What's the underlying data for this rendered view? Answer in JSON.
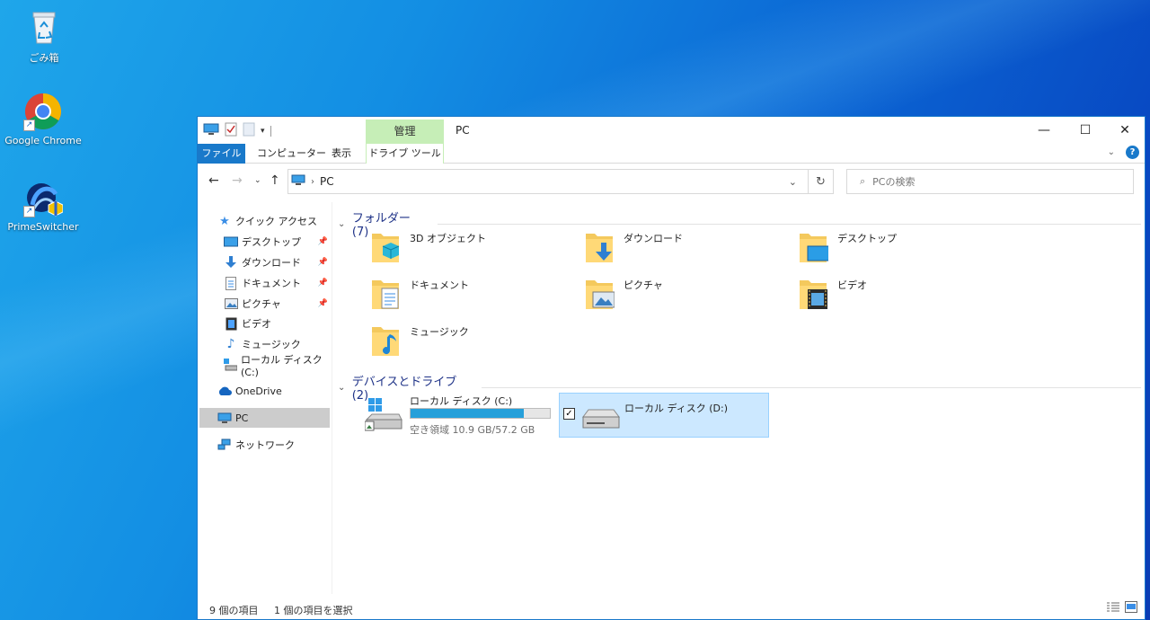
{
  "desktop": {
    "icons": [
      {
        "label": "ごみ箱",
        "icon": "recycle-bin-icon"
      },
      {
        "label": "Google Chrome",
        "icon": "chrome-icon"
      },
      {
        "label": "PrimeSwitcher",
        "icon": "primeswitcher-icon"
      }
    ]
  },
  "window": {
    "title": "PC",
    "context_tab_group": "管理",
    "ribbon_tabs": [
      "ファイル",
      "コンピューター",
      "表示",
      "ドライブ ツール"
    ],
    "address": {
      "path": "PC"
    },
    "search": {
      "placeholder": "PCの検索"
    },
    "controls": {
      "minimize": "—",
      "maximize": "☐",
      "close": "✕"
    }
  },
  "sidebar": {
    "quick_access": "クイック アクセス",
    "items": [
      {
        "label": "デスクトップ",
        "icon": "desktop-icon",
        "pinned": true
      },
      {
        "label": "ダウンロード",
        "icon": "download-icon",
        "pinned": true
      },
      {
        "label": "ドキュメント",
        "icon": "document-icon",
        "pinned": true
      },
      {
        "label": "ピクチャ",
        "icon": "picture-icon",
        "pinned": true
      },
      {
        "label": "ビデオ",
        "icon": "video-icon",
        "pinned": false
      },
      {
        "label": "ミュージック",
        "icon": "music-icon",
        "pinned": false
      },
      {
        "label": "ローカル ディスク (C:)",
        "icon": "drive-icon",
        "pinned": false
      }
    ],
    "onedrive": "OneDrive",
    "pc": "PC",
    "network": "ネットワーク"
  },
  "content": {
    "folders_header": "フォルダー (7)",
    "folders": [
      {
        "label": "3D オブジェクト",
        "icon": "3d-objects-folder-icon"
      },
      {
        "label": "ダウンロード",
        "icon": "downloads-folder-icon"
      },
      {
        "label": "デスクトップ",
        "icon": "desktop-folder-icon"
      },
      {
        "label": "ドキュメント",
        "icon": "documents-folder-icon"
      },
      {
        "label": "ピクチャ",
        "icon": "pictures-folder-icon"
      },
      {
        "label": "ビデオ",
        "icon": "videos-folder-icon"
      },
      {
        "label": "ミュージック",
        "icon": "music-folder-icon"
      }
    ],
    "devices_header": "デバイスとドライブ (2)",
    "drives": [
      {
        "label": "ローカル ディスク (C:)",
        "free_text": "空き領域 10.9 GB/57.2 GB",
        "used_fraction": 0.81,
        "icon": "windows-drive-icon"
      },
      {
        "label": "ローカル ディスク (D:)",
        "selected": true,
        "icon": "drive-icon"
      }
    ]
  },
  "status": {
    "item_count": "9 個の項目",
    "selection": "1 個の項目を選択"
  },
  "colors": {
    "accent": "#1979ca",
    "selection": "#cce8ff",
    "progress": "#26a0da",
    "context_tab": "#c6eeb7"
  }
}
